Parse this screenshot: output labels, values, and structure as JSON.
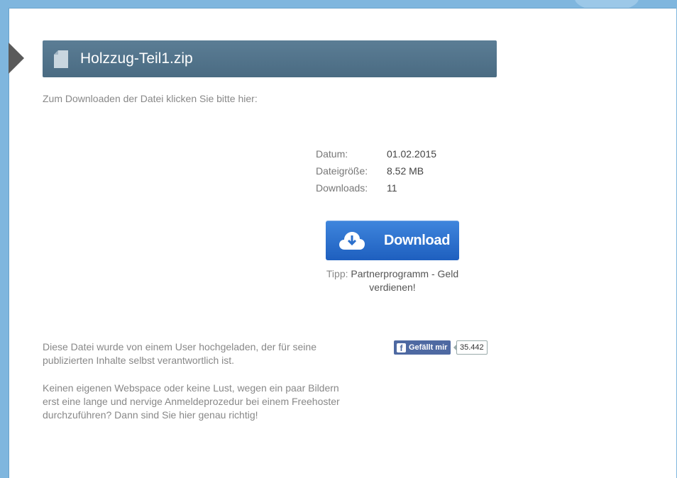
{
  "file": {
    "title": "Holzzug-Teil1.zip",
    "intro": "Zum Downloaden der Datei klicken Sie bitte hier:"
  },
  "meta": [
    {
      "label": "Datum:",
      "value": "01.02.2015"
    },
    {
      "label": "Dateigröße:",
      "value": "8.52 MB"
    },
    {
      "label": "Downloads:",
      "value": "11"
    }
  ],
  "download": {
    "label": "Download",
    "tip_prefix": "Tipp:",
    "tip_link": "Partnerprogramm - Geld verdienen!"
  },
  "notes": {
    "uploader": "Diese Datei wurde von einem User hochgeladen, der für seine publizierten Inhalte selbst verantwortlich ist.",
    "webspace": "Keinen eigenen Webspace oder keine Lust, wegen ein paar Bildern erst eine lange und nervige Anmeldeprozedur bei einem Freehoster durchzuführen? Dann sind Sie hier genau richtig!"
  },
  "facebook": {
    "like_label": "Gefällt mir",
    "count": "35.442"
  },
  "icons": {
    "file": "file-icon",
    "download": "cloud-download-icon",
    "facebook": "facebook-icon",
    "pointer": "arrow-right-icon"
  },
  "colors": {
    "accent": "#1e5fbf",
    "title_bar": "#4a6b82",
    "facebook": "#4e69a2"
  }
}
